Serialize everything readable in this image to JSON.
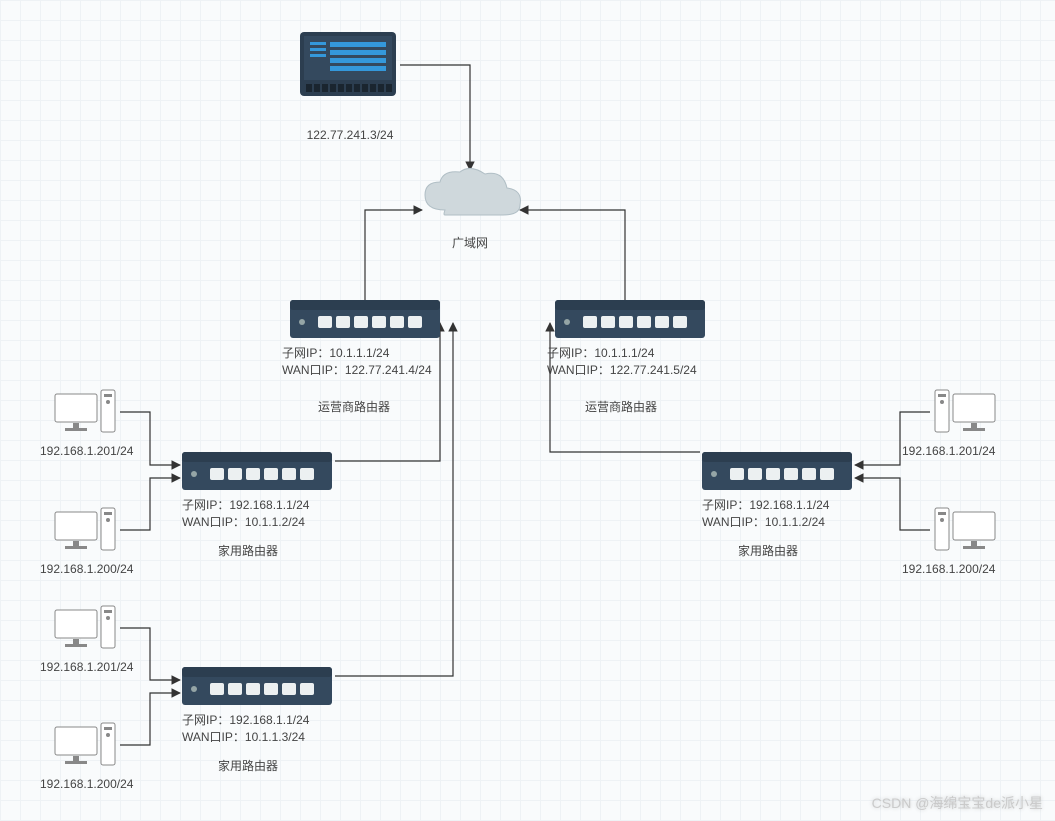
{
  "cloud": {
    "label": "广域网"
  },
  "server": {
    "ip": "122.77.241.3/24"
  },
  "isp_routers": [
    {
      "subnet_label": "子网IP：",
      "subnet_ip": "10.1.1.1/24",
      "wan_label": "WAN口IP：",
      "wan_ip": "122.77.241.4/24",
      "name": "运营商路由器"
    },
    {
      "subnet_label": "子网IP：",
      "subnet_ip": "10.1.1.1/24",
      "wan_label": "WAN口IP：",
      "wan_ip": "122.77.241.5/24",
      "name": "运营商路由器"
    }
  ],
  "home_routers": [
    {
      "subnet_label": "子网IP：",
      "subnet_ip": "192.168.1.1/24",
      "wan_label": "WAN口IP：",
      "wan_ip": "10.1.1.2/24",
      "name": "家用路由器"
    },
    {
      "subnet_label": "子网IP：",
      "subnet_ip": "192.168.1.1/24",
      "wan_label": "WAN口IP：",
      "wan_ip": "10.1.1.3/24",
      "name": "家用路由器"
    },
    {
      "subnet_label": "子网IP：",
      "subnet_ip": "192.168.1.1/24",
      "wan_label": "WAN口IP：",
      "wan_ip": "10.1.1.2/24",
      "name": "家用路由器"
    }
  ],
  "pcs": {
    "left_top": "192.168.1.201/24",
    "left_mid": "192.168.1.200/24",
    "left_bot1": "192.168.1.201/24",
    "left_bot2": "192.168.1.200/24",
    "right_top": "192.168.1.201/24",
    "right_bot": "192.168.1.200/24"
  },
  "watermark": "CSDN @海绵宝宝de派小星"
}
